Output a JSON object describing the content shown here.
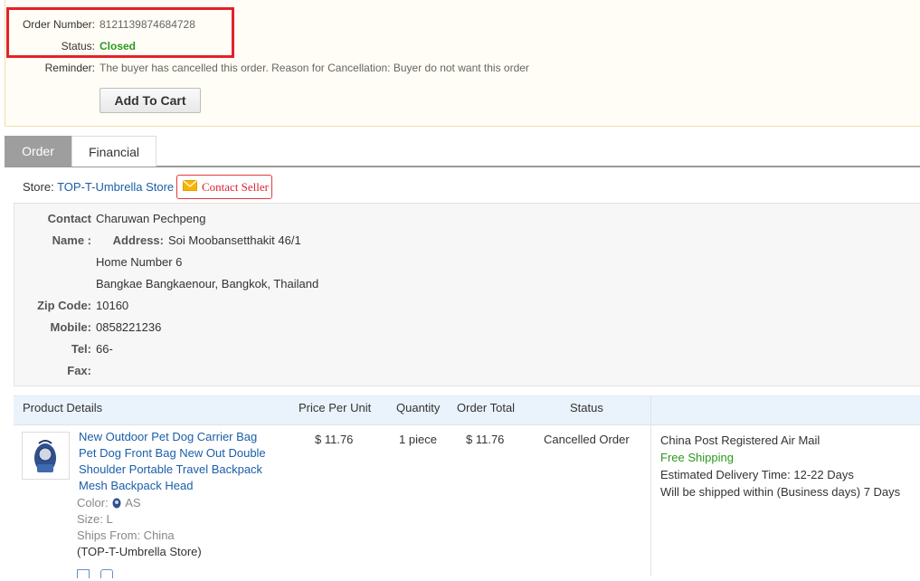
{
  "order": {
    "number_label": "Order Number:",
    "number": "8121139874684728",
    "status_label": "Status:",
    "status": "Closed",
    "reminder_label": "Reminder:",
    "reminder": "The buyer has cancelled this order. Reason for Cancellation: Buyer do not want this order",
    "add_to_cart": "Add To Cart"
  },
  "tabs": [
    {
      "label": "Order",
      "active": true
    },
    {
      "label": "Financial",
      "active": false
    }
  ],
  "store": {
    "label": "Store:",
    "name": "TOP-T-Umbrella Store",
    "contact_label": "Contact Seller"
  },
  "address": {
    "contact_label": "Contact",
    "contact_name": "Charuwan Pechpeng",
    "name_label": "Name :",
    "address_label": "Address:",
    "line1": "Soi Moobansetthakit 46/1",
    "line2": "Home Number 6",
    "line3": "Bangkae Bangkaenour, Bangkok, Thailand",
    "zip_label": "Zip Code:",
    "zip": "10160",
    "mobile_label": "Mobile:",
    "mobile": "0858221236",
    "tel_label": "Tel:",
    "tel": "66-",
    "fax_label": "Fax:",
    "fax": ""
  },
  "table": {
    "headers": [
      "Product Details",
      "Price Per Unit",
      "Quantity",
      "Order Total",
      "Status"
    ],
    "item": {
      "name_lines": [
        "New Outdoor Pet Dog Carrier Bag",
        "Pet Dog Front Bag New Out Double",
        "Shoulder Portable Travel Backpack",
        "Mesh Backpack Head"
      ],
      "color_label": "Color:",
      "color": "AS",
      "size": "Size: L",
      "ships_from": "Ships From: China",
      "store": "(TOP-T-Umbrella Store)",
      "price": "$ 11.76",
      "quantity": "1 piece",
      "total": "$ 11.76",
      "status": "Cancelled Order",
      "shipping_method": "China Post Registered Air Mail",
      "shipping_cost": "Free Shipping",
      "delivery_label": "Estimated Delivery Time:",
      "delivery": "12-22 Days",
      "ship_within": "Will be shipped within (Business days) 7 Days"
    }
  },
  "colors": {
    "status_closed": "#2b9a1e",
    "highlight_box": "#e32229",
    "link": "#1a5ea8",
    "tab_active": "#9e9e9e"
  }
}
